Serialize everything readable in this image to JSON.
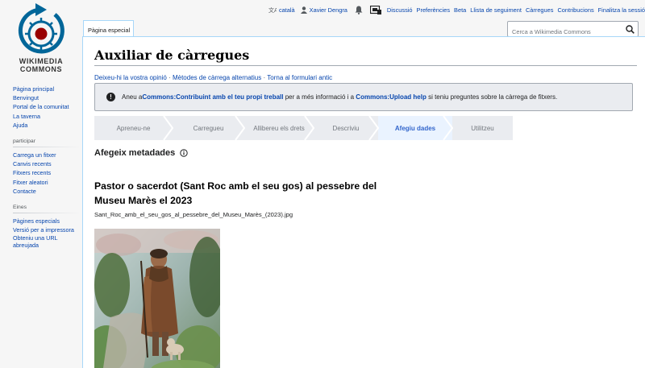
{
  "logo": {
    "line1": "WIKIMEDIA",
    "line2": "COMMONS"
  },
  "personal_tools": {
    "language": "català",
    "user": "Xavier Dengra",
    "discussion": "Discussió",
    "preferences": "Preferències",
    "beta": "Beta",
    "watchlist": "Llista de seguiment",
    "uploads": "Càrregues",
    "contributions": "Contribucions",
    "logout": "Finalitza la sessió"
  },
  "tab": {
    "label": "Pàgina especial"
  },
  "search": {
    "placeholder": "Cerca a Wikimedia Commons"
  },
  "page": {
    "title": "Auxiliar de càrregues",
    "links": [
      "Deixeu-hi la vostra opinió",
      "Mètodes de càrrega alternatius",
      "Torna al formulari antic"
    ],
    "link_separator": "·"
  },
  "notice": {
    "prefix": "Aneu a ",
    "link1": "Commons:Contribuint amb el teu propi treball",
    "middle": " per a més informació i a ",
    "link2": "Commons:Upload help",
    "suffix": " si teniu preguntes sobre la càrrega de fitxers."
  },
  "steps": [
    {
      "label": "Apreneu-ne",
      "active": false
    },
    {
      "label": "Carregueu",
      "active": false
    },
    {
      "label": "Allibereu els drets",
      "active": false
    },
    {
      "label": "Descriviu",
      "active": false
    },
    {
      "label": "Afegiu dades",
      "active": true
    },
    {
      "label": "Utilitzeu",
      "active": false
    }
  ],
  "section": {
    "heading": "Afegeix metadades"
  },
  "file": {
    "title": "Pastor o sacerdot (Sant Roc amb el seu gos) al pessebre del Museu Marès el 2023",
    "filename": "Sant_Roc_amb_el_seu_gos_al_pessebre_del_Museu_Marès_(2023).jpg"
  },
  "sidebar": {
    "main": [
      "Pàgina principal",
      "Benvingut",
      "Portal de la comunitat",
      "La taverna",
      "Ajuda"
    ],
    "participate": {
      "heading": "participar",
      "items": [
        "Carrega un fitxer",
        "Canvis recents",
        "Fitxers recents",
        "Fitxer aleatori",
        "Contacte"
      ]
    },
    "tools": {
      "heading": "Eines",
      "items": [
        "Pàgines especials",
        "Versió per a impressora",
        "Obteniu una URL abreujada"
      ]
    }
  },
  "colors": {
    "link": "#0645ad",
    "active_step": "#3366cc",
    "logo_blue": "#006699",
    "logo_red": "#990000"
  }
}
